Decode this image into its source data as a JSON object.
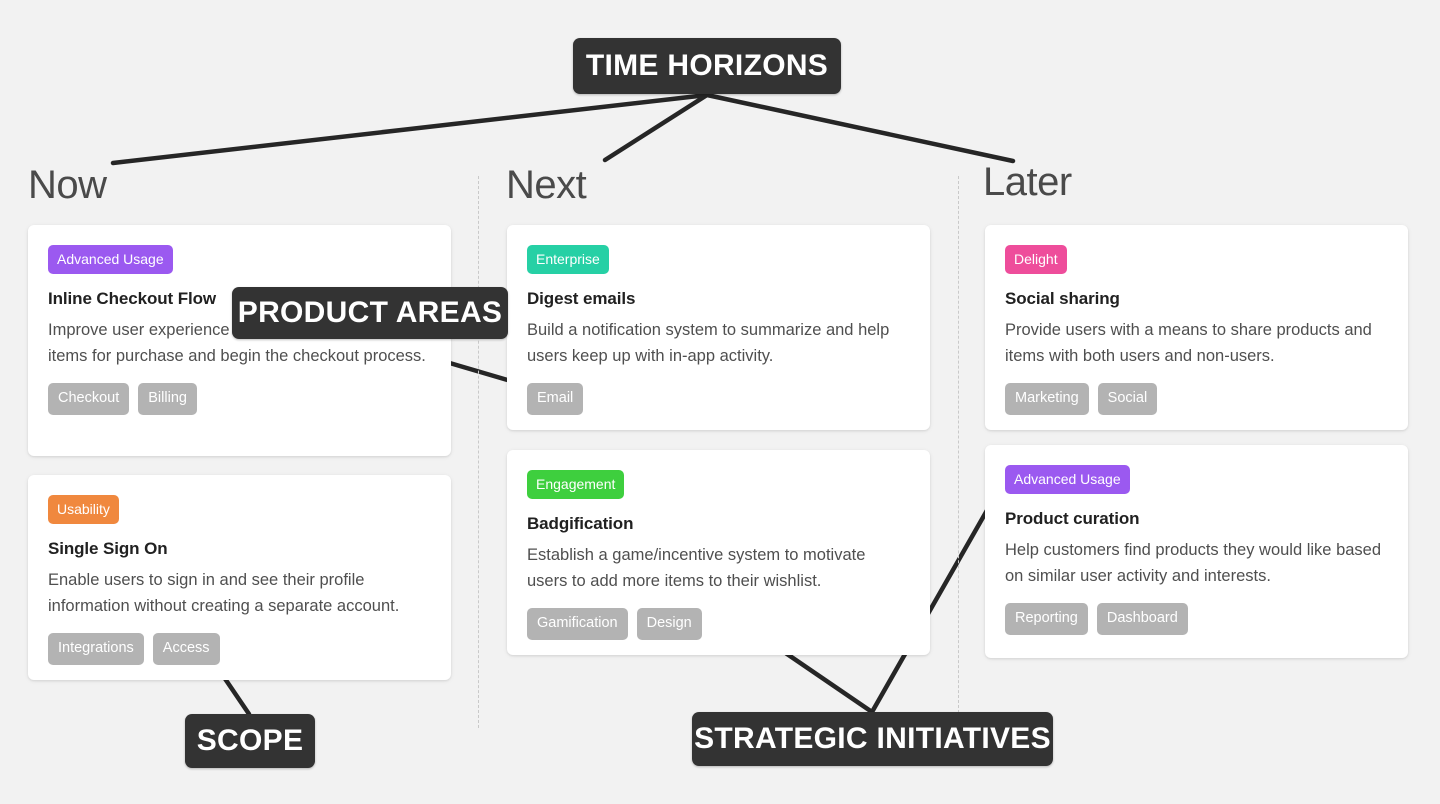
{
  "columns": [
    {
      "id": "now",
      "label": "Now"
    },
    {
      "id": "next",
      "label": "Next"
    },
    {
      "id": "later",
      "label": "Later"
    }
  ],
  "callouts": {
    "time_horizons": "TIME HORIZONS",
    "product_areas": "PRODUCT AREAS",
    "scope": "SCOPE",
    "strategic_initiatives": "STRATEGIC INITIATIVES"
  },
  "palette": {
    "background": "#f2f2f2",
    "card": "#ffffff",
    "callout": "#333333",
    "tag_grey": "#b3b3b3",
    "divider": "#c9c9c9",
    "badge_advanced_usage": "#9b59f0",
    "badge_usability": "#f0883e",
    "badge_enterprise": "#26d0a5",
    "badge_engagement": "#3ecf3e",
    "badge_delight": "#ee4d9b"
  },
  "cards": {
    "now": [
      {
        "badge": "Advanced Usage",
        "badge_color": "#9b59f0",
        "title": "Inline Checkout Flow",
        "description": "Improve user experience by allowing users to select items for purchase and begin the checkout process.",
        "tags": [
          "Checkout",
          "Billing"
        ]
      },
      {
        "badge": "Usability",
        "badge_color": "#f0883e",
        "title": "Single Sign On",
        "description": "Enable users to sign in and see their profile information without creating a separate account.",
        "tags": [
          "Integrations",
          "Access"
        ]
      }
    ],
    "next": [
      {
        "badge": "Enterprise",
        "badge_color": "#26d0a5",
        "title": "Digest emails",
        "description": "Build a notification system to summarize and help users keep up with in-app activity.",
        "tags": [
          "Email"
        ]
      },
      {
        "badge": "Engagement",
        "badge_color": "#3ecf3e",
        "title": "Badgification",
        "description": "Establish a game/incentive system to motivate users to add more items to their wishlist.",
        "tags": [
          "Gamification",
          "Design"
        ]
      }
    ],
    "later": [
      {
        "badge": "Delight",
        "badge_color": "#ee4d9b",
        "title": "Social sharing",
        "description": "Provide users with a means to share products and items with both users and non-users.",
        "tags": [
          "Marketing",
          "Social"
        ]
      },
      {
        "badge": "Advanced Usage",
        "badge_color": "#9b59f0",
        "title": "Product curation",
        "description": "Help customers find products they would like based on similar user activity and interests.",
        "tags": [
          "Reporting",
          "Dashboard"
        ]
      }
    ]
  }
}
